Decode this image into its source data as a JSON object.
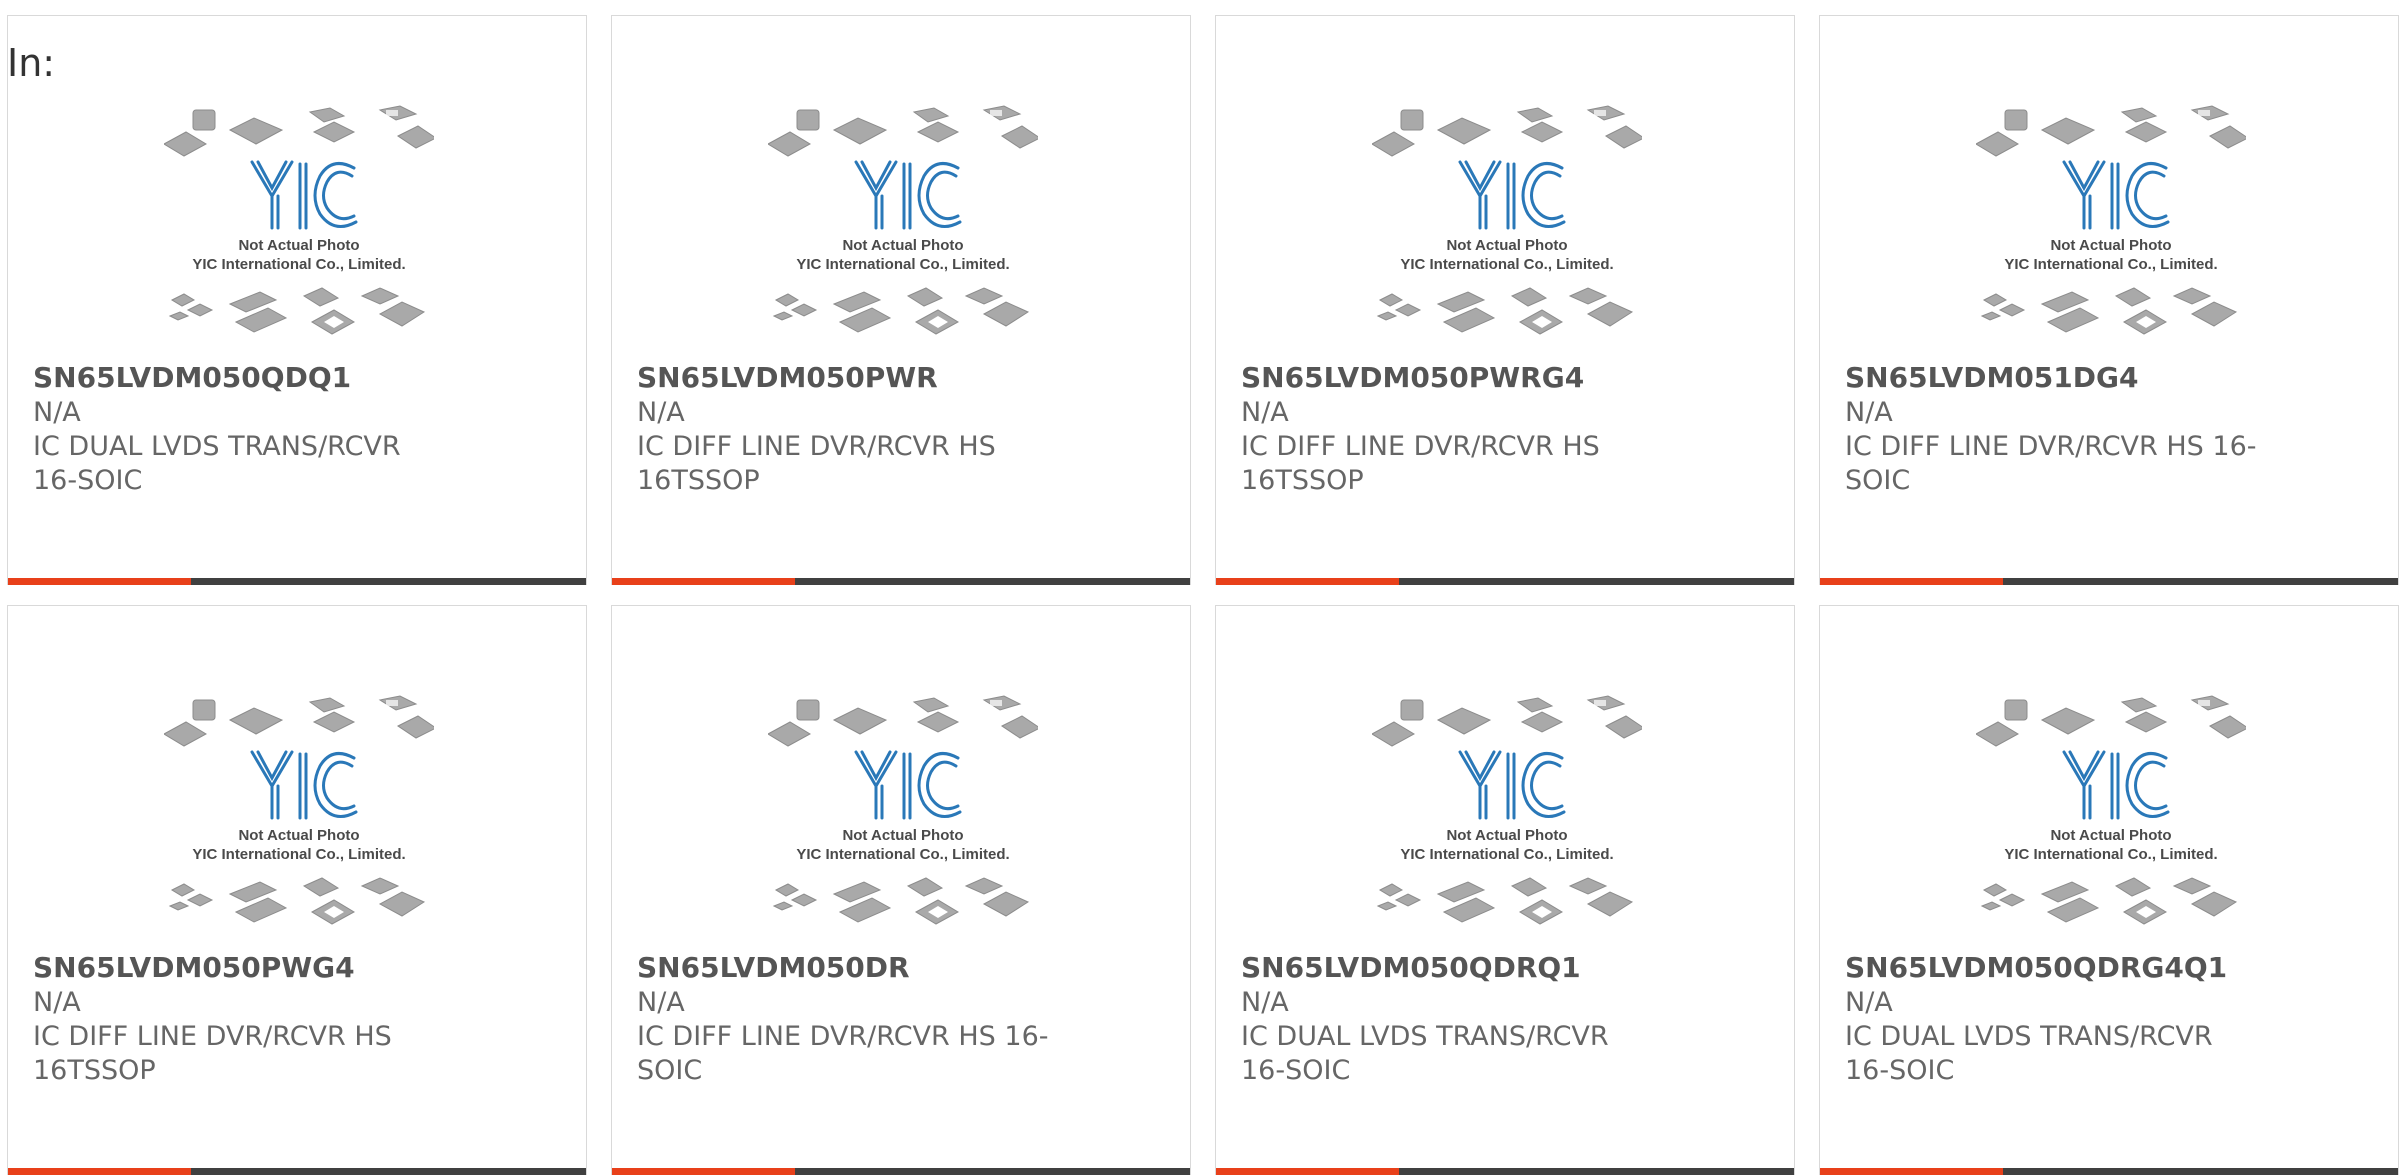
{
  "header": {
    "in_label": "In:"
  },
  "thumbnail": {
    "caption_line1": "Not Actual Photo",
    "caption_line2": "YIC International Co., Limited.",
    "logo_text": "YIC",
    "brand_color": "#2a78b8",
    "icon": "chip-packages-placeholder-icon"
  },
  "accent_colors": {
    "orange": "#e8401a",
    "dark": "#404040"
  },
  "products": [
    {
      "part_number": "SN65LVDM050QDQ1",
      "manufacturer": "N/A",
      "description": "IC DUAL LVDS TRANS/RCVR 16-SOIC"
    },
    {
      "part_number": "SN65LVDM050PWR",
      "manufacturer": "N/A",
      "description": "IC DIFF LINE DVR/RCVR HS 16TSSOP"
    },
    {
      "part_number": "SN65LVDM050PWRG4",
      "manufacturer": "N/A",
      "description": "IC DIFF LINE DVR/RCVR HS 16TSSOP"
    },
    {
      "part_number": "SN65LVDM051DG4",
      "manufacturer": "N/A",
      "description": "IC DIFF LINE DVR/RCVR HS 16-SOIC"
    },
    {
      "part_number": "SN65LVDM050PWG4",
      "manufacturer": "N/A",
      "description": "IC DIFF LINE DVR/RCVR HS 16TSSOP"
    },
    {
      "part_number": "SN65LVDM050DR",
      "manufacturer": "N/A",
      "description": "IC DIFF LINE DVR/RCVR HS 16-SOIC"
    },
    {
      "part_number": "SN65LVDM050QDRQ1",
      "manufacturer": "N/A",
      "description": "IC DUAL LVDS TRANS/RCVR 16-SOIC"
    },
    {
      "part_number": "SN65LVDM050QDRG4Q1",
      "manufacturer": "N/A",
      "description": "IC DUAL LVDS TRANS/RCVR 16-SOIC"
    }
  ]
}
